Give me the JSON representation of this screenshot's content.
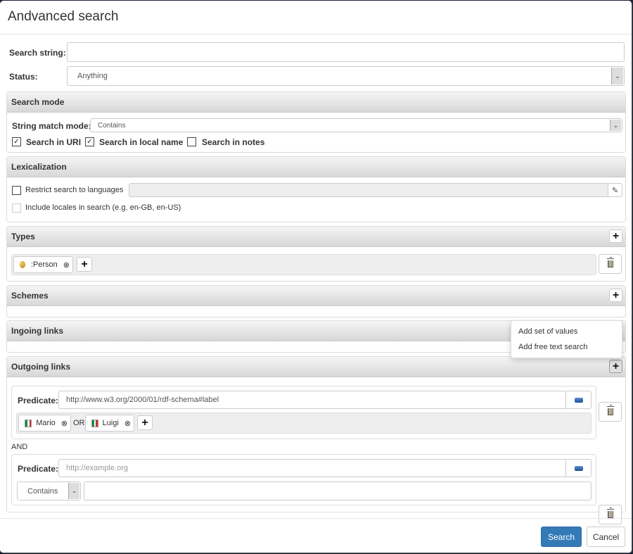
{
  "dialog": {
    "title": "Andvanced search"
  },
  "search": {
    "string_label": "Search string:",
    "string_value": "",
    "status_label": "Status:",
    "status_value": "Anything"
  },
  "search_mode": {
    "heading": "Search mode",
    "match_label": "String match mode:",
    "match_value": "Contains",
    "options": [
      {
        "label": "Search in URI",
        "checked": true
      },
      {
        "label": "Search in local name",
        "checked": true
      },
      {
        "label": "Search in notes",
        "checked": false
      }
    ]
  },
  "lexicalization": {
    "heading": "Lexicalization",
    "restrict_label": "Restrict search to languages",
    "restrict_checked": false,
    "languages_value": "",
    "include_locales_label": "Include locales in search (e.g. en-GB, en-US)",
    "include_locales_checked": false,
    "include_locales_disabled": true
  },
  "types": {
    "heading": "Types",
    "items": [
      {
        "label": ":Person",
        "icon": "class-bullet-icon"
      }
    ]
  },
  "schemes": {
    "heading": "Schemes"
  },
  "ingoing": {
    "heading": "Ingoing links"
  },
  "outgoing": {
    "heading": "Outgoing links",
    "conjunction": "AND",
    "disjunction": "OR",
    "filters": [
      {
        "predicate_label": "Predicate:",
        "predicate_value": "http://www.w3.org/2000/01/rdf-schema#label",
        "values": [
          {
            "label": "Mario",
            "flag": "it"
          },
          {
            "label": "Luigi",
            "flag": "it"
          }
        ]
      },
      {
        "predicate_label": "Predicate:",
        "predicate_placeholder": "http://example.org",
        "mode_value": "Contains",
        "text_value": ""
      }
    ]
  },
  "add_menu": {
    "items": [
      "Add set of values",
      "Add free text search"
    ]
  },
  "footer": {
    "search_label": "Search",
    "cancel_label": "Cancel"
  },
  "colors": {
    "primary": "#337ab7",
    "panel_heading_top": "#f5f5f5",
    "panel_heading_bottom": "#d7d7d7",
    "flag_it": [
      "#009246",
      "#ffffff",
      "#ce2b37"
    ]
  }
}
